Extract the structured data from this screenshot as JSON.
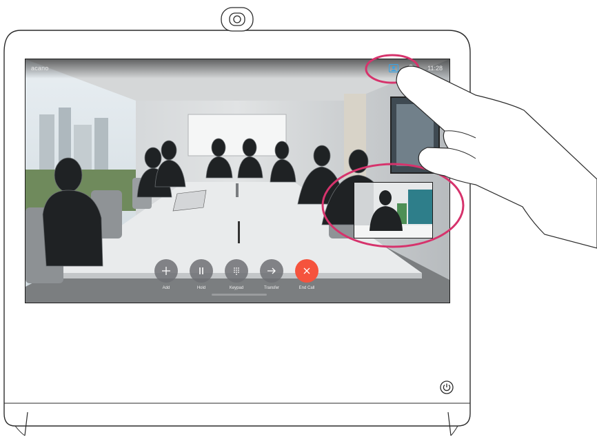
{
  "call": {
    "name": "acano",
    "time": "11:28"
  },
  "icons": {
    "selfview": "selfview-icon",
    "contact": "person-icon",
    "power": "power-icon",
    "camera": "camera-icon"
  },
  "controls": [
    {
      "label": "Add",
      "icon": "plus-icon"
    },
    {
      "label": "Hold",
      "icon": "pause-icon"
    },
    {
      "label": "Keypad",
      "icon": "keypad-icon"
    },
    {
      "label": "Transfer",
      "icon": "arrow-right-icon"
    },
    {
      "label": "End Call",
      "icon": "close-icon"
    }
  ],
  "colors": {
    "end_call": "#f5533d",
    "highlight": "#d6336c",
    "selfview_icon": "#3aa3e3"
  }
}
